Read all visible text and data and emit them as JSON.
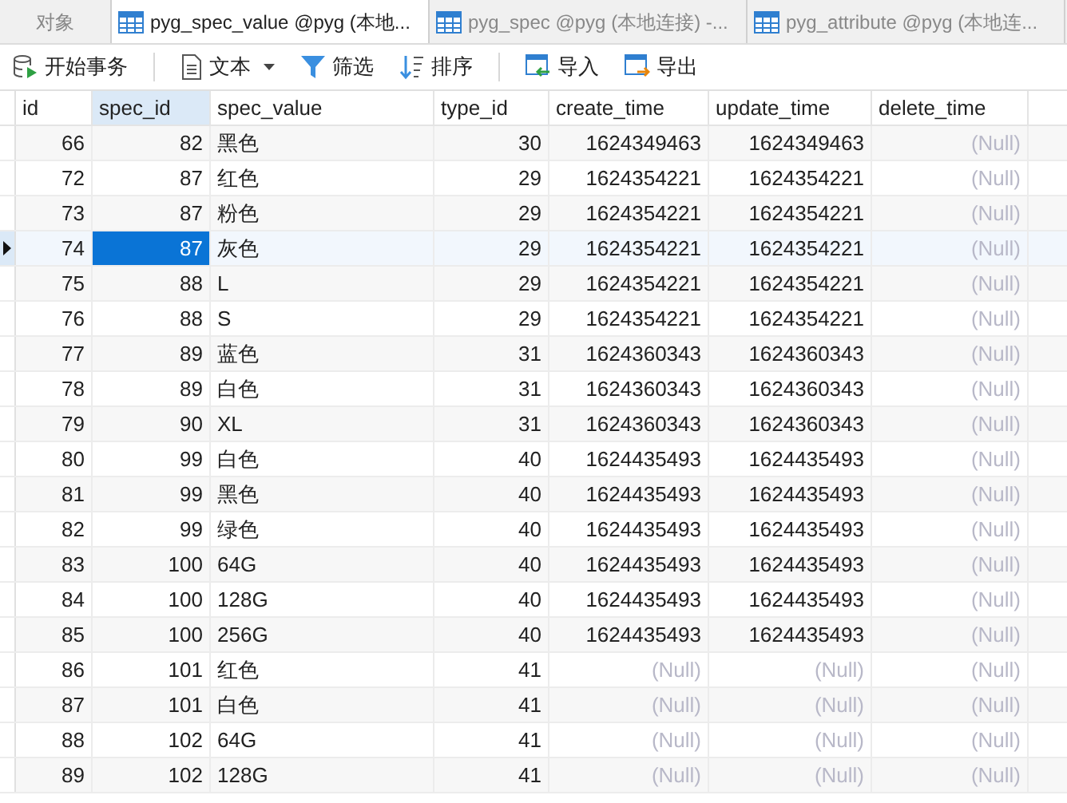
{
  "tabs": [
    {
      "label": "对象",
      "kind": "plain",
      "selected": false
    },
    {
      "label": "pyg_spec_value @pyg (本地...",
      "kind": "table",
      "selected": true
    },
    {
      "label": "pyg_spec @pyg (本地连接) -...",
      "kind": "table",
      "selected": false
    },
    {
      "label": "pyg_attribute @pyg (本地连...",
      "kind": "table",
      "selected": false
    }
  ],
  "toolbar": [
    {
      "label": "开始事务",
      "kind": "transaction"
    },
    {
      "label": "文本",
      "kind": "text"
    },
    {
      "label": "筛选",
      "kind": "filter"
    },
    {
      "label": "排序",
      "kind": "sort"
    },
    {
      "label": "导入",
      "kind": "import"
    },
    {
      "label": "导出",
      "kind": "export"
    }
  ],
  "table": {
    "columns": [
      {
        "label": "id",
        "kind": "number",
        "selected": false
      },
      {
        "label": "spec_id",
        "kind": "number",
        "selected": true
      },
      {
        "label": "spec_value",
        "kind": "text",
        "selected": false
      },
      {
        "label": "type_id",
        "kind": "number",
        "selected": false
      },
      {
        "label": "create_time",
        "kind": "number",
        "selected": false
      },
      {
        "label": "update_time",
        "kind": "number",
        "selected": false
      },
      {
        "label": "delete_time",
        "kind": "number",
        "selected": false
      }
    ],
    "rows": [
      {
        "selected": false,
        "cells": [
          "66",
          "82",
          "黑色",
          "30",
          "1624349463",
          "1624349463",
          {
            "text": "(Null)",
            "null": true
          }
        ]
      },
      {
        "selected": false,
        "cells": [
          "72",
          "87",
          "红色",
          "29",
          "1624354221",
          "1624354221",
          {
            "text": "(Null)",
            "null": true
          }
        ]
      },
      {
        "selected": false,
        "cells": [
          "73",
          "87",
          "粉色",
          "29",
          "1624354221",
          "1624354221",
          {
            "text": "(Null)",
            "null": true
          }
        ]
      },
      {
        "selected": true,
        "cells": [
          "74",
          "87",
          "灰色",
          "29",
          "1624354221",
          "1624354221",
          {
            "text": "(Null)",
            "null": true
          }
        ]
      },
      {
        "selected": false,
        "cells": [
          "75",
          "88",
          "L",
          "29",
          "1624354221",
          "1624354221",
          {
            "text": "(Null)",
            "null": true
          }
        ]
      },
      {
        "selected": false,
        "cells": [
          "76",
          "88",
          "S",
          "29",
          "1624354221",
          "1624354221",
          {
            "text": "(Null)",
            "null": true
          }
        ]
      },
      {
        "selected": false,
        "cells": [
          "77",
          "89",
          "蓝色",
          "31",
          "1624360343",
          "1624360343",
          {
            "text": "(Null)",
            "null": true
          }
        ]
      },
      {
        "selected": false,
        "cells": [
          "78",
          "89",
          "白色",
          "31",
          "1624360343",
          "1624360343",
          {
            "text": "(Null)",
            "null": true
          }
        ]
      },
      {
        "selected": false,
        "cells": [
          "79",
          "90",
          "XL",
          "31",
          "1624360343",
          "1624360343",
          {
            "text": "(Null)",
            "null": true
          }
        ]
      },
      {
        "selected": false,
        "cells": [
          "80",
          "99",
          "白色",
          "40",
          "1624435493",
          "1624435493",
          {
            "text": "(Null)",
            "null": true
          }
        ]
      },
      {
        "selected": false,
        "cells": [
          "81",
          "99",
          "黑色",
          "40",
          "1624435493",
          "1624435493",
          {
            "text": "(Null)",
            "null": true
          }
        ]
      },
      {
        "selected": false,
        "cells": [
          "82",
          "99",
          "绿色",
          "40",
          "1624435493",
          "1624435493",
          {
            "text": "(Null)",
            "null": true
          }
        ]
      },
      {
        "selected": false,
        "cells": [
          "83",
          "100",
          "64G",
          "40",
          "1624435493",
          "1624435493",
          {
            "text": "(Null)",
            "null": true
          }
        ]
      },
      {
        "selected": false,
        "cells": [
          "84",
          "100",
          "128G",
          "40",
          "1624435493",
          "1624435493",
          {
            "text": "(Null)",
            "null": true
          }
        ]
      },
      {
        "selected": false,
        "cells": [
          "85",
          "100",
          "256G",
          "40",
          "1624435493",
          "1624435493",
          {
            "text": "(Null)",
            "null": true
          }
        ]
      },
      {
        "selected": false,
        "cells": [
          "86",
          "101",
          "红色",
          "41",
          {
            "text": "(Null)",
            "null": true
          },
          {
            "text": "(Null)",
            "null": true
          },
          {
            "text": "(Null)",
            "null": true
          }
        ]
      },
      {
        "selected": false,
        "cells": [
          "87",
          "101",
          "白色",
          "41",
          {
            "text": "(Null)",
            "null": true
          },
          {
            "text": "(Null)",
            "null": true
          },
          {
            "text": "(Null)",
            "null": true
          }
        ]
      },
      {
        "selected": false,
        "cells": [
          "88",
          "102",
          "64G",
          "41",
          {
            "text": "(Null)",
            "null": true
          },
          {
            "text": "(Null)",
            "null": true
          },
          {
            "text": "(Null)",
            "null": true
          }
        ]
      },
      {
        "selected": false,
        "cells": [
          "89",
          "102",
          "128G",
          "41",
          {
            "text": "(Null)",
            "null": true
          },
          {
            "text": "(Null)",
            "null": true
          },
          {
            "text": "(Null)",
            "null": true
          }
        ]
      }
    ]
  }
}
